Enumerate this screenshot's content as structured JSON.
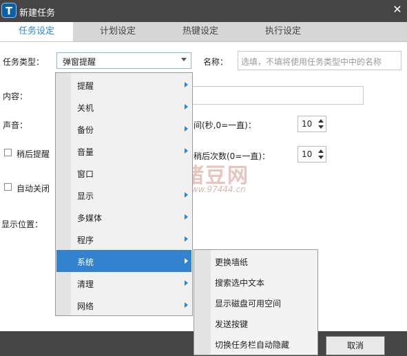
{
  "window": {
    "title": "新建任务",
    "logo_letter": "T",
    "close_glyph": "✕"
  },
  "tabs": [
    {
      "label": "任务设定",
      "active": true
    },
    {
      "label": "计划设定",
      "active": false
    },
    {
      "label": "热键设定",
      "active": false
    },
    {
      "label": "执行设定",
      "active": false
    }
  ],
  "form": {
    "task_type_label": "任务类型：",
    "task_type_value": "弹窗提醒",
    "name_label": "名称：",
    "name_placeholder": "选填，不填将使用任务类型中中的名称",
    "content_label": "内容：",
    "sound_label": "声音：",
    "interval_label": "间(秒,0=一直)：",
    "interval_value": "10",
    "snooze_label": "稍后提醒",
    "snooze_count_label": "稍后次数(0=一直)：",
    "snooze_count_value": "10",
    "auto_close_label": "自动关闭",
    "position_label": "显示位置："
  },
  "menu": {
    "items": [
      {
        "label": "提醒",
        "has_submenu": true
      },
      {
        "label": "关机",
        "has_submenu": true
      },
      {
        "label": "备份",
        "has_submenu": true
      },
      {
        "label": "音量",
        "has_submenu": true
      },
      {
        "label": "窗口",
        "has_submenu": false
      },
      {
        "label": "显示",
        "has_submenu": true
      },
      {
        "label": "多媒体",
        "has_submenu": true
      },
      {
        "label": "程序",
        "has_submenu": true
      },
      {
        "label": "系统",
        "has_submenu": true,
        "selected": true
      },
      {
        "label": "清理",
        "has_submenu": true
      },
      {
        "label": "网络",
        "has_submenu": true
      }
    ]
  },
  "submenu": {
    "items": [
      "更换墙纸",
      "搜索选中文本",
      "显示磁盘可用空间",
      "发送按键",
      "切换任务栏自动隐藏"
    ]
  },
  "watermark": {
    "name": "猪豆网",
    "url": "www.97444.cn"
  },
  "footer": {
    "cancel_label": "取消"
  },
  "colors": {
    "accent": "#2a88d0",
    "selected_bg": "#3282ce",
    "titlebar": "#454545"
  }
}
